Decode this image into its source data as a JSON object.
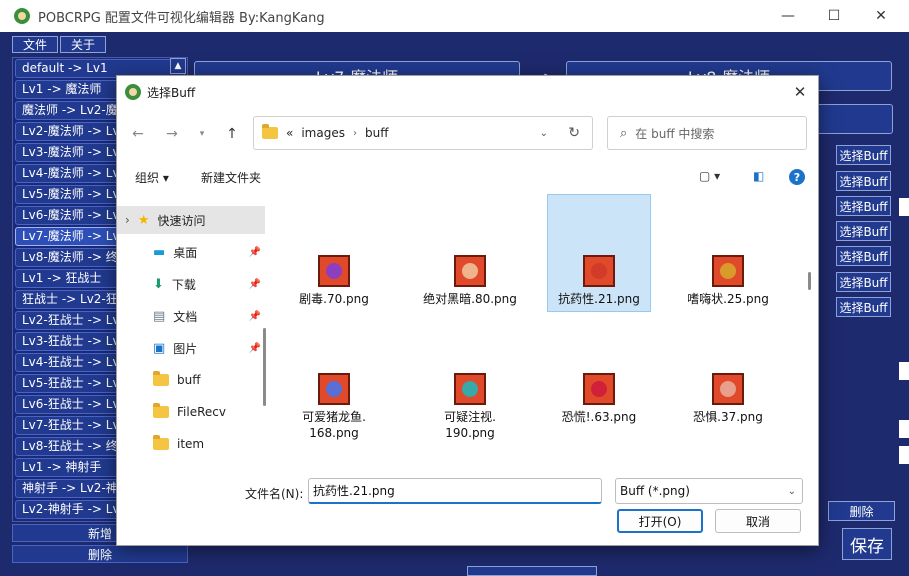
{
  "main": {
    "title": "POBCRPG 配置文件可视化编辑器 By:KangKang",
    "menu": [
      "文件",
      "关于"
    ],
    "list_items": [
      "default -> Lv1",
      "Lv1 -> 魔法师",
      "魔法师 -> Lv2-魔",
      "Lv2-魔法师 -> Lv",
      "Lv3-魔法师 -> Lv",
      "Lv4-魔法师 -> Lv",
      "Lv5-魔法师 -> Lv",
      "Lv6-魔法师 -> Lv",
      "Lv7-魔法师 -> Lv",
      "Lv8-魔法师 -> 终",
      "Lv1 -> 狂战士",
      "狂战士 -> Lv2-狂",
      "Lv2-狂战士 -> Lv",
      "Lv3-狂战士 -> Lv",
      "Lv4-狂战士 -> Lv",
      "Lv5-狂战士 -> Lv",
      "Lv6-狂战士 -> Lv",
      "Lv7-狂战士 -> Lv",
      "Lv8-狂战士 -> 终",
      "Lv1 -> 神射手",
      "神射手 -> Lv2-神",
      "Lv2-神射手 -> Lv"
    ],
    "selected_index": 8,
    "add_label": "新增",
    "delete_label": "删除",
    "tab_left": "Lv7-魔法师",
    "tab_right": "Lv8-魔法师",
    "arrow": "->",
    "buff_button": "选择Buff",
    "buff_button_count": 7,
    "right_delete": "删除",
    "save": "保存"
  },
  "dialog": {
    "title": "选择Buff",
    "path": [
      "images",
      "buff"
    ],
    "path_prefix": "«",
    "search_placeholder": "在 buff 中搜索",
    "organize": "组织",
    "new_folder": "新建文件夹",
    "sidebar": [
      {
        "label": "快速访问",
        "icon": "star-icon",
        "pinned": false
      },
      {
        "label": "桌面",
        "icon": "desktop-icon",
        "pinned": true
      },
      {
        "label": "下载",
        "icon": "download-icon",
        "pinned": true
      },
      {
        "label": "文档",
        "icon": "document-icon",
        "pinned": true
      },
      {
        "label": "图片",
        "icon": "pictures-icon",
        "pinned": true
      },
      {
        "label": "buff",
        "icon": "folder-icon",
        "pinned": false
      },
      {
        "label": "FileRecv",
        "icon": "folder-icon",
        "pinned": false
      },
      {
        "label": "item",
        "icon": "folder-icon",
        "pinned": false
      }
    ],
    "files": [
      {
        "name": "剧毒.70.png",
        "color": "#8e3fbf"
      },
      {
        "name": "绝对黑暗.80.png",
        "color": "#f0b48c"
      },
      {
        "name": "抗药性.21.png",
        "color": "#d23a2a"
      },
      {
        "name": "嗜嗨状.25.png",
        "color": "#d89a2a"
      },
      {
        "name": "可爱猪龙鱼.\n168.png",
        "color": "#5a6fd6"
      },
      {
        "name": "可疑注视.\n190.png",
        "color": "#38a8a8"
      },
      {
        "name": "恐慌!.63.png",
        "color": "#d0203a"
      },
      {
        "name": "恐惧.37.png",
        "color": "#e8a08c"
      }
    ],
    "selected_file": 2,
    "filename_label": "文件名(N):",
    "filename_value": "抗药性.21.png",
    "filetype": "Buff (*.png)",
    "open": "打开(O)",
    "cancel": "取消"
  }
}
